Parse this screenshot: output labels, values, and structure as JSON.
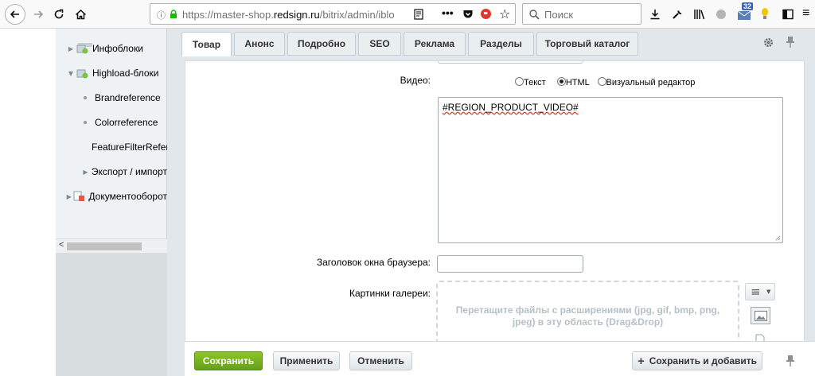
{
  "browser": {
    "url_prefix": "https://master-shop.",
    "url_domain": "redsign.ru",
    "url_suffix": "/bitrix/admin/iblo",
    "search_placeholder": "Поиск",
    "badge_count": "32"
  },
  "sidebar": {
    "items": [
      {
        "label": "Инфоблоки"
      },
      {
        "label": "Highload-блоки"
      },
      {
        "label": "Brandreference"
      },
      {
        "label": "Colorreference"
      },
      {
        "label": "FeatureFilterRefer"
      },
      {
        "label": "Экспорт / импорт"
      },
      {
        "label": "Документооборот"
      }
    ],
    "scroll_left": "<"
  },
  "tabs": [
    {
      "label": "Товар"
    },
    {
      "label": "Анонс"
    },
    {
      "label": "Подробно"
    },
    {
      "label": "SEO"
    },
    {
      "label": "Реклама"
    },
    {
      "label": "Разделы"
    },
    {
      "label": "Торговый каталог"
    }
  ],
  "form": {
    "video_label": "Видео:",
    "radio_text": "Текст",
    "radio_html": "HTML",
    "radio_visual": "Визуальный редактор",
    "video_value": "#REGION_PRODUCT_VIDEO#",
    "browser_title_label": "Заголовок окна браузера:",
    "browser_title_value": "",
    "gallery_label": "Картинки галереи:",
    "gallery_drop_text": "Перетащите файлы с расширениями (jpg, gif, bmp, png, jpeg) в эту область (Drag&Drop)"
  },
  "footer": {
    "save": "Сохранить",
    "apply": "Применить",
    "cancel": "Отменить",
    "save_add": "Сохранить и добавить"
  }
}
